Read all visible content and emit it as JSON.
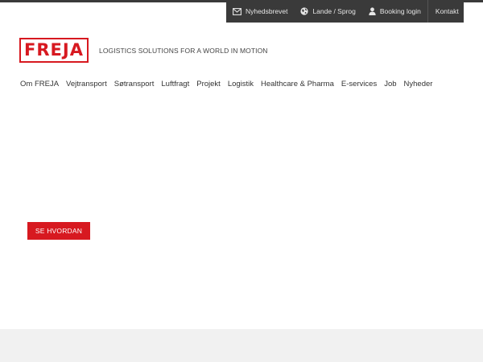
{
  "utility": {
    "newsletter": "Nyhedsbrevet",
    "countries": "Lande / Sprog",
    "booking": "Booking login",
    "contact": "Kontakt"
  },
  "brand": {
    "logo_text": "FREJA",
    "tagline": "LOGISTICS SOLUTIONS FOR A WORLD IN MOTION",
    "accent_color": "#d71920"
  },
  "nav": {
    "items": [
      "Om FREJA",
      "Vejtransport",
      "Søtransport",
      "Luftfragt",
      "Projekt",
      "Logistik",
      "Healthcare & Pharma",
      "E-services",
      "Job",
      "Nyheder"
    ]
  },
  "hero": {
    "cta_label": "SE HVORDAN"
  },
  "icons": {
    "newsletter": "envelope-icon",
    "countries": "globe-icon",
    "booking": "user-icon"
  }
}
